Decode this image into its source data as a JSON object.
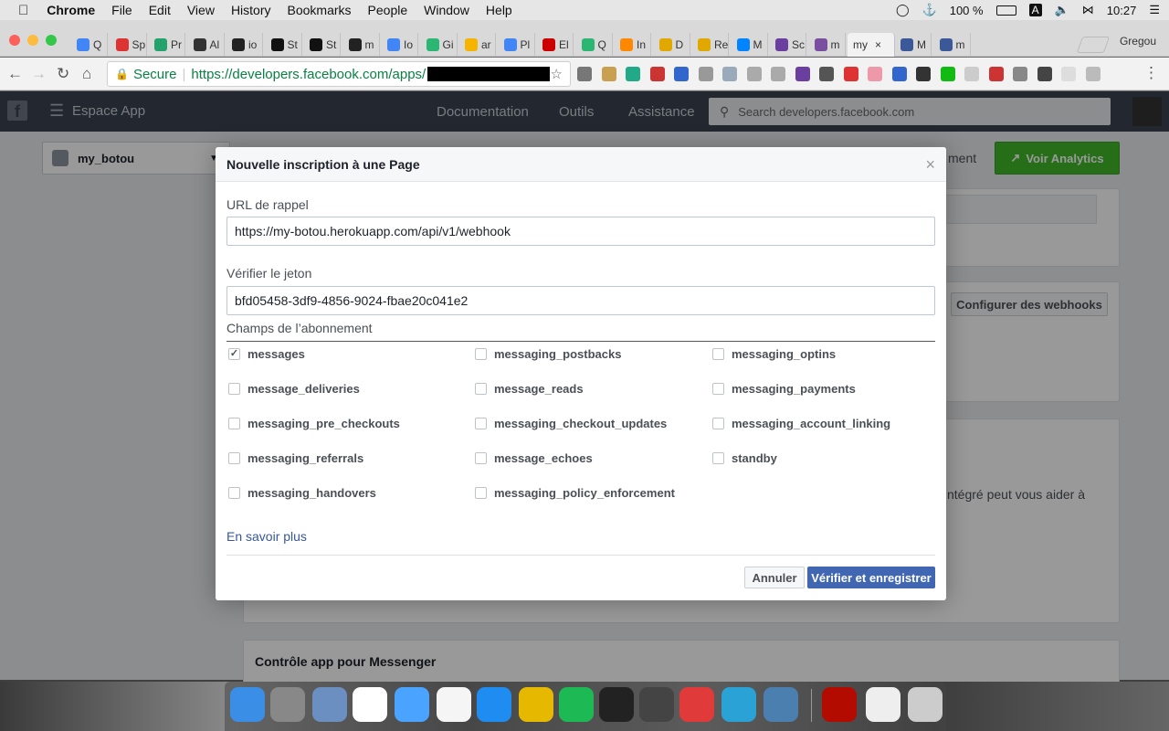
{
  "menubar": {
    "app": "Chrome",
    "items": [
      "File",
      "Edit",
      "View",
      "History",
      "Bookmarks",
      "People",
      "Window",
      "Help"
    ],
    "battery": "100 %",
    "input_source": "A",
    "time": "10:27"
  },
  "tabs": [
    "Q",
    "Sp",
    "Pr",
    "Al",
    "io",
    "St",
    "St",
    "m",
    "Io",
    "Gi",
    "ar",
    "Pl",
    "El",
    "Q",
    "In",
    "D",
    "Re",
    "M",
    "Sc",
    "m",
    "my",
    "M",
    "m"
  ],
  "profile_name": "Gregou",
  "omnibox": {
    "secure_label": "Secure",
    "url": "https://developers.facebook.com/apps/"
  },
  "fb_header": {
    "app_space": "Espace App",
    "nav": [
      "Documentation",
      "Outils",
      "Assistance"
    ],
    "search_placeholder": "Search developers.facebook.com"
  },
  "page": {
    "app_name": "my_botou",
    "analytics_button": "Voir Analytics",
    "peek_text_1": "ment",
    "webhooks_button": "Configurer des webhooks",
    "peek_text_2": "ntégré peut vous aider à",
    "section_title": "Contrôle app pour Messenger"
  },
  "dialog": {
    "title": "Nouvelle inscription à une Page",
    "callback_label": "URL de rappel",
    "callback_value": "https://my-botou.herokuapp.com/api/v1/webhook",
    "token_label": "Vérifier le jeton",
    "token_value": "bfd05458-3df9-4856-9024-fbae20c041e2",
    "fields_label": "Champs de l’abonnement",
    "fields": [
      {
        "name": "messages",
        "checked": true
      },
      {
        "name": "messaging_postbacks",
        "checked": false
      },
      {
        "name": "messaging_optins",
        "checked": false
      },
      {
        "name": "message_deliveries",
        "checked": false
      },
      {
        "name": "message_reads",
        "checked": false
      },
      {
        "name": "messaging_payments",
        "checked": false
      },
      {
        "name": "messaging_pre_checkouts",
        "checked": false
      },
      {
        "name": "messaging_checkout_updates",
        "checked": false
      },
      {
        "name": "messaging_account_linking",
        "checked": false
      },
      {
        "name": "messaging_referrals",
        "checked": false
      },
      {
        "name": "message_echoes",
        "checked": false
      },
      {
        "name": "standby",
        "checked": false
      },
      {
        "name": "messaging_handovers",
        "checked": false
      },
      {
        "name": "messaging_policy_enforcement",
        "checked": false
      }
    ],
    "learn_more": "En savoir plus",
    "cancel": "Annuler",
    "submit": "Vérifier et enregistrer"
  },
  "colors": {
    "fb_header": "#3b4451",
    "primary_button": "#4267b2",
    "analytics_green": "#42b72a",
    "secure_green": "#0a8043",
    "link": "#365899"
  }
}
